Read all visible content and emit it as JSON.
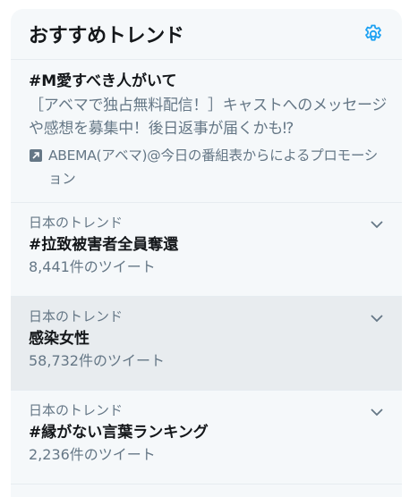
{
  "header": {
    "title": "おすすめトレンド",
    "settings_icon": "gear-icon"
  },
  "promo": {
    "title": "#M愛すべき人がいて",
    "description": "［アベマで独占無料配信！］キャストへのメッセージや感想を募集中！後日返事が届くかも⁉",
    "promoted_by": "ABEMA(アベマ)@今日の番組表からによるプロモーション",
    "icon": "promoted-icon"
  },
  "trends": [
    {
      "meta": "日本のトレンド",
      "name": "#拉致被害者全員奪還",
      "count": "8,441件のツイート"
    },
    {
      "meta": "日本のトレンド",
      "name": "感染女性",
      "count": "58,732件のツイート"
    },
    {
      "meta": "日本のトレンド",
      "name": "#縁がない言葉ランキング",
      "count": "2,236件のツイート"
    }
  ],
  "colors": {
    "accent": "#1da1f2",
    "panel_bg": "#f5f8fa",
    "secondary_text": "#657786"
  }
}
